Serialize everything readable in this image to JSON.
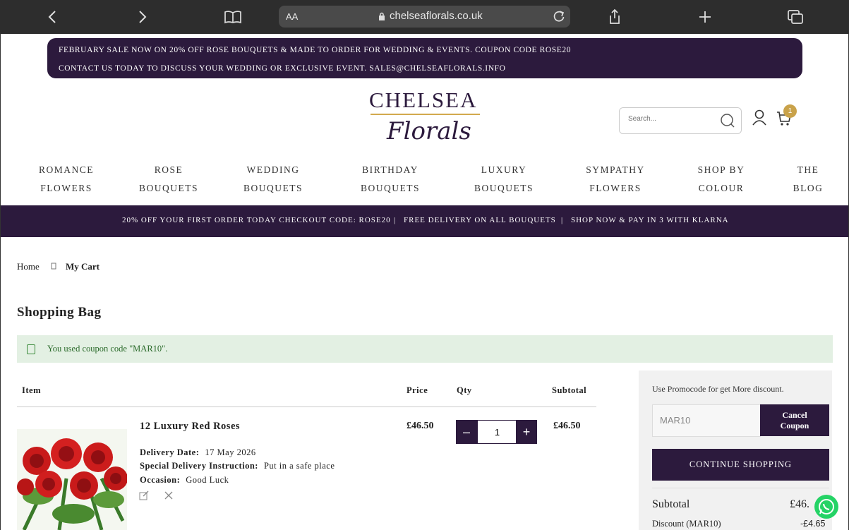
{
  "browser": {
    "url_prefix": "AA",
    "host": "chelseaflorals.co.uk"
  },
  "promo": {
    "line1": "FEBRUARY SALE NOW ON 20% OFF ROSE BOUQUETS & MADE TO ORDER FOR WEDDING & EVENTS. COUPON CODE ROSE20",
    "line2": "CONTACT US TODAY TO DISCUSS YOUR WEDDING OR EXCLUSIVE EVENT. SALES@CHELSEAFLORALS.INFO"
  },
  "logo": {
    "top": "CHELSEA",
    "bottom": "Florals"
  },
  "search": {
    "placeholder": "Search..."
  },
  "cart_count": "1",
  "nav": [
    {
      "l1": "ROMANCE",
      "l2": "FLOWERS"
    },
    {
      "l1": "ROSE",
      "l2": "BOUQUETS"
    },
    {
      "l1": "WEDDING",
      "l2": "BOUQUETS"
    },
    {
      "l1": "BIRTHDAY",
      "l2": "BOUQUETS"
    },
    {
      "l1": "LUXURY",
      "l2": "BOUQUETS"
    },
    {
      "l1": "SYMPATHY",
      "l2": "FLOWERS"
    },
    {
      "l1": "SHOP BY",
      "l2": "COLOUR"
    },
    {
      "l1": "THE",
      "l2": "BLOG"
    }
  ],
  "offer_bar": {
    "item1": "20% OFF YOUR FIRST ORDER TODAY CHECKOUT CODE: ROSE20",
    "item2": "FREE DELIVERY ON ALL BOUQUETS",
    "item3": "SHOP NOW & PAY IN 3 WITH KLARNA",
    "sep": "|"
  },
  "breadcrumb": {
    "home": "Home",
    "current": "My Cart"
  },
  "page_title": "Shopping Bag",
  "alert": "You used coupon code \"MAR10\".",
  "table": {
    "item": "Item",
    "price": "Price",
    "qty": "Qty",
    "subtotal": "Subtotal"
  },
  "product": {
    "name": "12 Luxury Red Roses",
    "delivery_label": "Delivery Date:",
    "delivery_value": "17 May 2026",
    "instruction_label": "Special Delivery Instruction:",
    "instruction_value": "Put in a safe place",
    "occasion_label": "Occasion:",
    "occasion_value": "Good Luck",
    "price": "£46.50",
    "qty": "1",
    "subtotal": "£46.50"
  },
  "summary": {
    "hint": "Use Promocode for get More discount.",
    "coupon_value": "MAR10",
    "cancel_line1": "Cancel",
    "cancel_line2": "Coupon",
    "continue": "CONTINUE SHOPPING",
    "subtotal_label": "Subtotal",
    "subtotal_value": "£46.",
    "discount_label": "Discount (MAR10)",
    "discount_value": "-£4.65"
  }
}
